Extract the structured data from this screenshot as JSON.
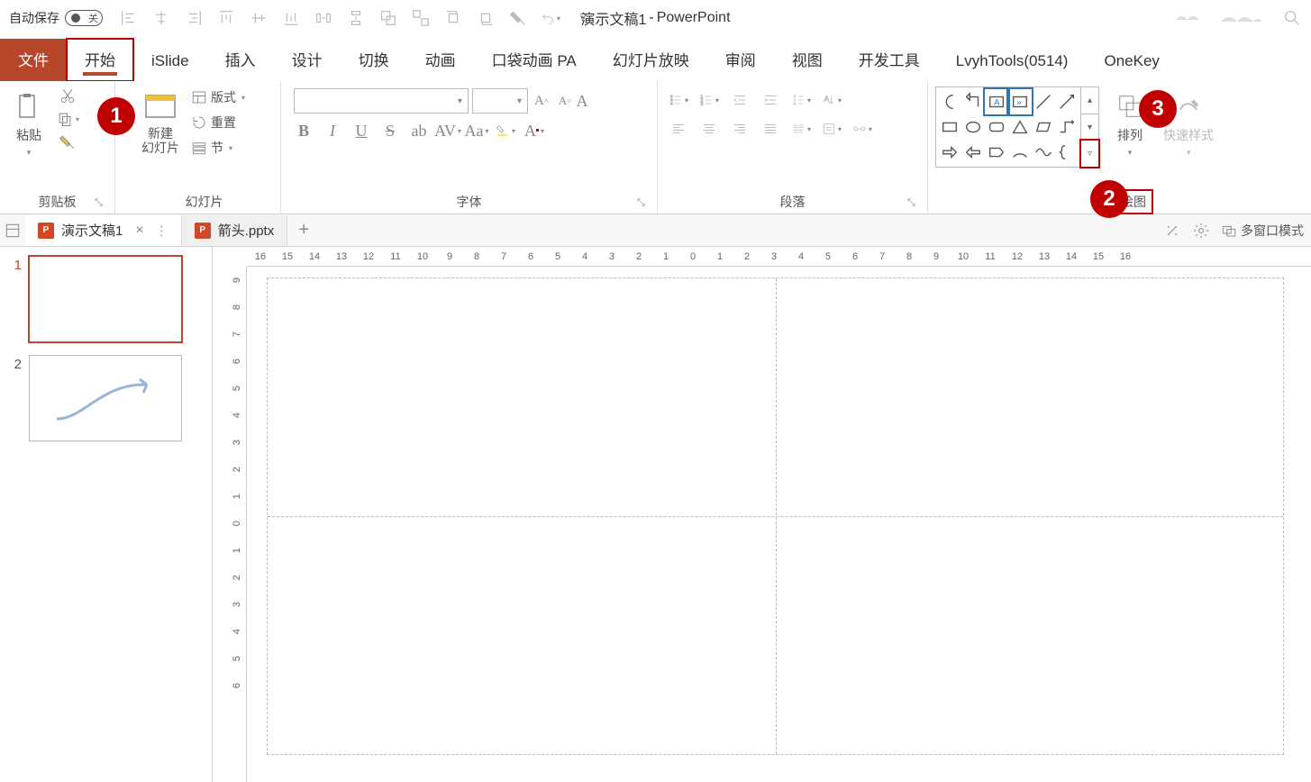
{
  "titlebar": {
    "autosave_label": "自动保存",
    "autosave_toggle_text": "关",
    "app_name": "PowerPoint",
    "doc_title": "演示文稿1",
    "separator": " - "
  },
  "qat_icons": [
    "align-left",
    "align-center-h",
    "align-right",
    "align-top",
    "align-center-v",
    "align-bottom",
    "distribute-h",
    "distribute-v",
    "group",
    "ungroup",
    "bring-forward",
    "send-backward",
    "format-painter",
    "undo"
  ],
  "tabs": {
    "file": "文件",
    "home": "开始",
    "islide": "iSlide",
    "insert": "插入",
    "design": "设计",
    "transitions": "切换",
    "animations": "动画",
    "pa": "口袋动画 PA",
    "slideshow": "幻灯片放映",
    "review": "审阅",
    "view": "视图",
    "developer": "开发工具",
    "lvyh": "LvyhTools(0514)",
    "onekey": "OneKey"
  },
  "groups": {
    "clipboard": {
      "label": "剪贴板",
      "paste": "粘贴"
    },
    "slides": {
      "label": "幻灯片",
      "new_slide": "新建\n幻灯片",
      "layout": "版式",
      "reset": "重置",
      "section": "节"
    },
    "font": {
      "label": "字体"
    },
    "paragraph": {
      "label": "段落"
    },
    "drawing": {
      "label": "绘图",
      "arrange": "排列",
      "quick_styles": "快速样式"
    }
  },
  "doc_tabs": {
    "tab1": "演示文稿1",
    "tab2": "箭头.pptx",
    "multiwindow": "多窗口模式"
  },
  "callouts": {
    "c1": "1",
    "c2": "2",
    "c3": "3"
  },
  "thumbs": {
    "n1": "1",
    "n2": "2"
  },
  "h_ruler": [
    "16",
    "15",
    "14",
    "13",
    "12",
    "11",
    "10",
    "9",
    "8",
    "7",
    "6",
    "5",
    "4",
    "3",
    "2",
    "1",
    "0",
    "1",
    "2",
    "3",
    "4",
    "5",
    "6",
    "7",
    "8",
    "9",
    "10",
    "11",
    "12",
    "13",
    "14",
    "15",
    "16"
  ],
  "v_ruler": [
    "9",
    "8",
    "7",
    "6",
    "5",
    "4",
    "3",
    "2",
    "1",
    "0",
    "1",
    "2",
    "3",
    "4",
    "5",
    "6"
  ]
}
